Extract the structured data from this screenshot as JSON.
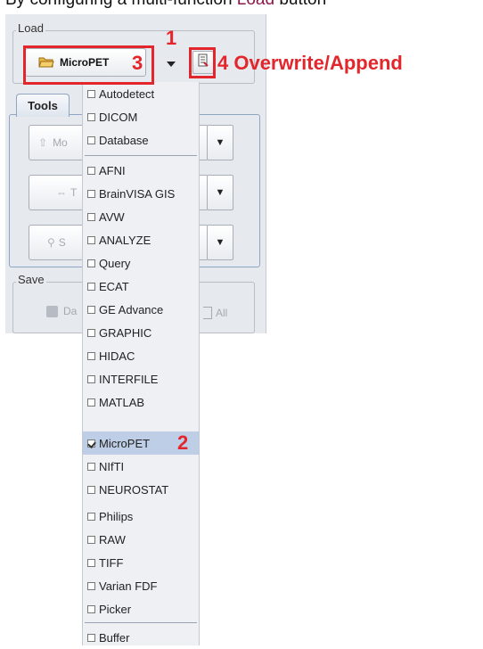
{
  "caption": {
    "prefix": "By configuring a multi-function",
    "keyword": "Load",
    "suffix": "button"
  },
  "load_group": {
    "legend": "Load",
    "button_label": "MicroPET"
  },
  "tools": {
    "tab_label": "Tools",
    "buttons": [
      "Mo",
      "T",
      "S"
    ]
  },
  "save_group": {
    "legend": "Save",
    "button_label": "Da",
    "checkbox_label": "All"
  },
  "menu": {
    "items": [
      {
        "label": "Autodetect",
        "checked": false
      },
      {
        "label": "DICOM",
        "checked": false
      },
      {
        "label": "Database",
        "checked": false
      },
      {
        "label": "AFNI",
        "checked": false
      },
      {
        "label": "BrainVISA GIS",
        "checked": false
      },
      {
        "label": "AVW",
        "checked": false
      },
      {
        "label": "ANALYZE",
        "checked": false
      },
      {
        "label": "Query",
        "checked": false
      },
      {
        "label": "ECAT",
        "checked": false
      },
      {
        "label": "GE Advance",
        "checked": false
      },
      {
        "label": "GRAPHIC",
        "checked": false
      },
      {
        "label": "HIDAC",
        "checked": false
      },
      {
        "label": "INTERFILE",
        "checked": false
      },
      {
        "label": "MATLAB",
        "checked": false
      },
      {
        "label": "MicroPET",
        "checked": true
      },
      {
        "label": "NIfTI",
        "checked": false
      },
      {
        "label": "NEUROSTAT",
        "checked": false
      },
      {
        "label": "Philips",
        "checked": false
      },
      {
        "label": "RAW",
        "checked": false
      },
      {
        "label": "TIFF",
        "checked": false
      },
      {
        "label": "Varian FDF",
        "checked": false
      },
      {
        "label": "Picker",
        "checked": false
      },
      {
        "label": "Buffer",
        "checked": false
      }
    ]
  },
  "annotations": {
    "n1": "1",
    "n2": "2",
    "n3": "3",
    "n4": "4 Overwrite/Append"
  },
  "colors": {
    "annotation": "#e3262c",
    "keyword": "#8b1a4a",
    "selected": "#bdcee6"
  }
}
